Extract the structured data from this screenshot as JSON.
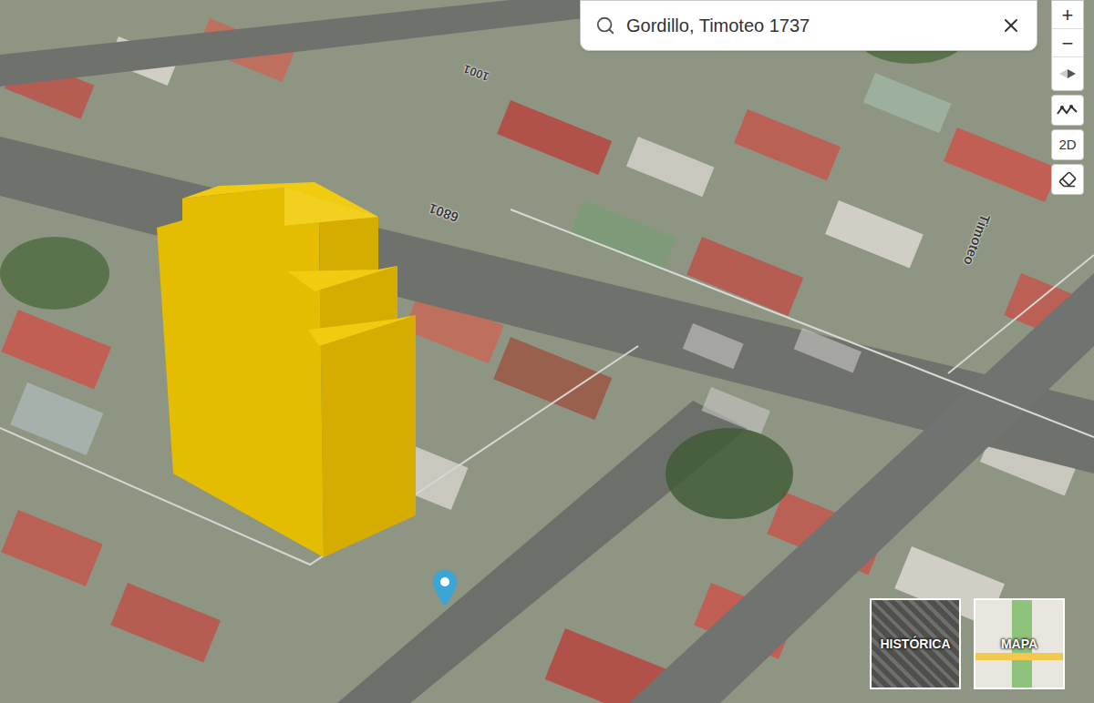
{
  "search": {
    "query": "Gordillo, Timoteo 1737"
  },
  "controls": {
    "zoom_in": "+",
    "zoom_out": "−",
    "view_mode": "2D"
  },
  "map_labels": [
    {
      "text": "6801"
    },
    {
      "text": "1001"
    },
    {
      "text": "Timoteo"
    }
  ],
  "layers": [
    {
      "label": "HISTÓRICA",
      "selected": false
    },
    {
      "label": "MAPA",
      "selected": false
    }
  ]
}
